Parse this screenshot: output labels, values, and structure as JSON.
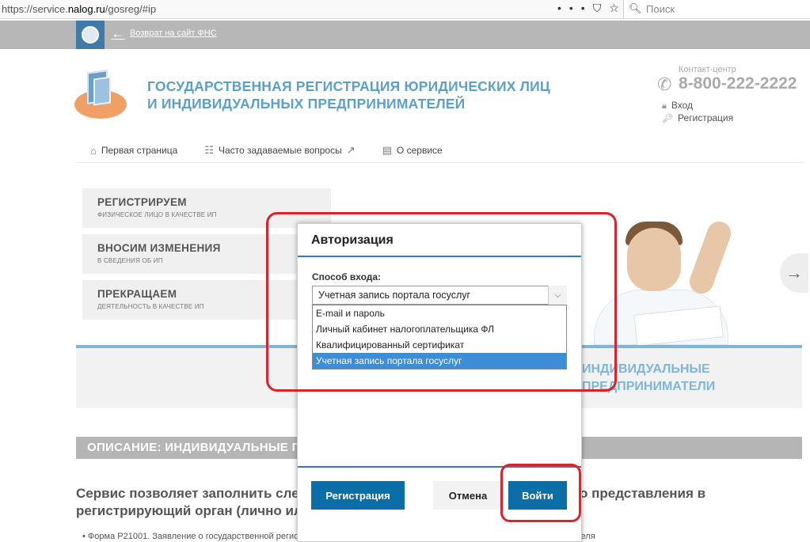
{
  "browser": {
    "url_prefix": "https://service.",
    "url_domain": "nalog.ru",
    "url_suffix": "/gosreg/#ip",
    "search_placeholder": "Поиск",
    "icons": [
      "more-dots-icon",
      "pocket-icon",
      "bookmark-star-icon",
      "search-icon"
    ]
  },
  "topbar": {
    "back_link": "Возврат на сайт ФНС"
  },
  "header": {
    "title_line1": "ГОСУДАРСТВЕННАЯ РЕГИСТРАЦИЯ ЮРИДИЧЕСКИХ ЛИЦ",
    "title_line2": "И ИНДИВИДУАЛЬНЫХ ПРЕДПРИНИМАТЕЛЕЙ",
    "contact_label": "Контакт-центр",
    "phone": "8-800-222-2222",
    "login_link": "Вход",
    "register_link": "Регистрация"
  },
  "nav": {
    "items": [
      {
        "label": "Первая страница",
        "icon": "home-icon"
      },
      {
        "label": "Часто задаваемые вопросы",
        "icon": "faq-icon"
      },
      {
        "label": "О сервисе",
        "icon": "info-doc-icon"
      }
    ]
  },
  "menu": [
    {
      "title": "РЕГИСТРИРУЕМ",
      "subtitle": "ФИЗИЧЕСКОЕ ЛИЦО В КАЧЕСТВЕ ИП"
    },
    {
      "title": "ВНОСИМ ИЗМЕНЕНИЯ",
      "subtitle": "В СВЕДЕНИЯ ОБ ИП"
    },
    {
      "title": "ПРЕКРАЩАЕМ",
      "subtitle": "ДЕЯТЕЛЬНОСТЬ В КАЧЕСТВЕ ИП"
    }
  ],
  "banner": {
    "title_line1": "ИНДИВИДУАЛЬНЫЕ",
    "title_line2": "ПРЕДПРИНИМАТЕЛИ"
  },
  "description": {
    "bar_title": "ОПИСАНИЕ: ИНДИВИДУАЛЬНЫЕ ПРЕДПРИНИМАТЕЛИ",
    "text_line1_start": "Сервис позволяет заполнить сле",
    "text_line1_end": "о представления в",
    "text_line2_start": "регистрирующий орган (лично ил",
    "bullet": "Форма Р21001. Заявление о государственной регистрации физического лица в качестве индивидуального предпринимателя"
  },
  "modal": {
    "title": "Авторизация",
    "field_label": "Способ входа:",
    "selected_value": "Учетная запись портала госуслуг",
    "options": [
      "E-mail и пароль",
      "Личный кабинет налогоплательщика ФЛ",
      "Квалифицированный сертификат",
      "Учетная запись портала госуслуг"
    ],
    "selected_index": 3,
    "btn_register": "Регистрация",
    "btn_cancel": "Отмена",
    "btn_login": "Войти"
  },
  "colors": {
    "accent_blue": "#0c6ea6",
    "title_blue": "#5ba0cd",
    "annotation_red": "#e0202a",
    "selected_option": "#3d8ed6"
  }
}
